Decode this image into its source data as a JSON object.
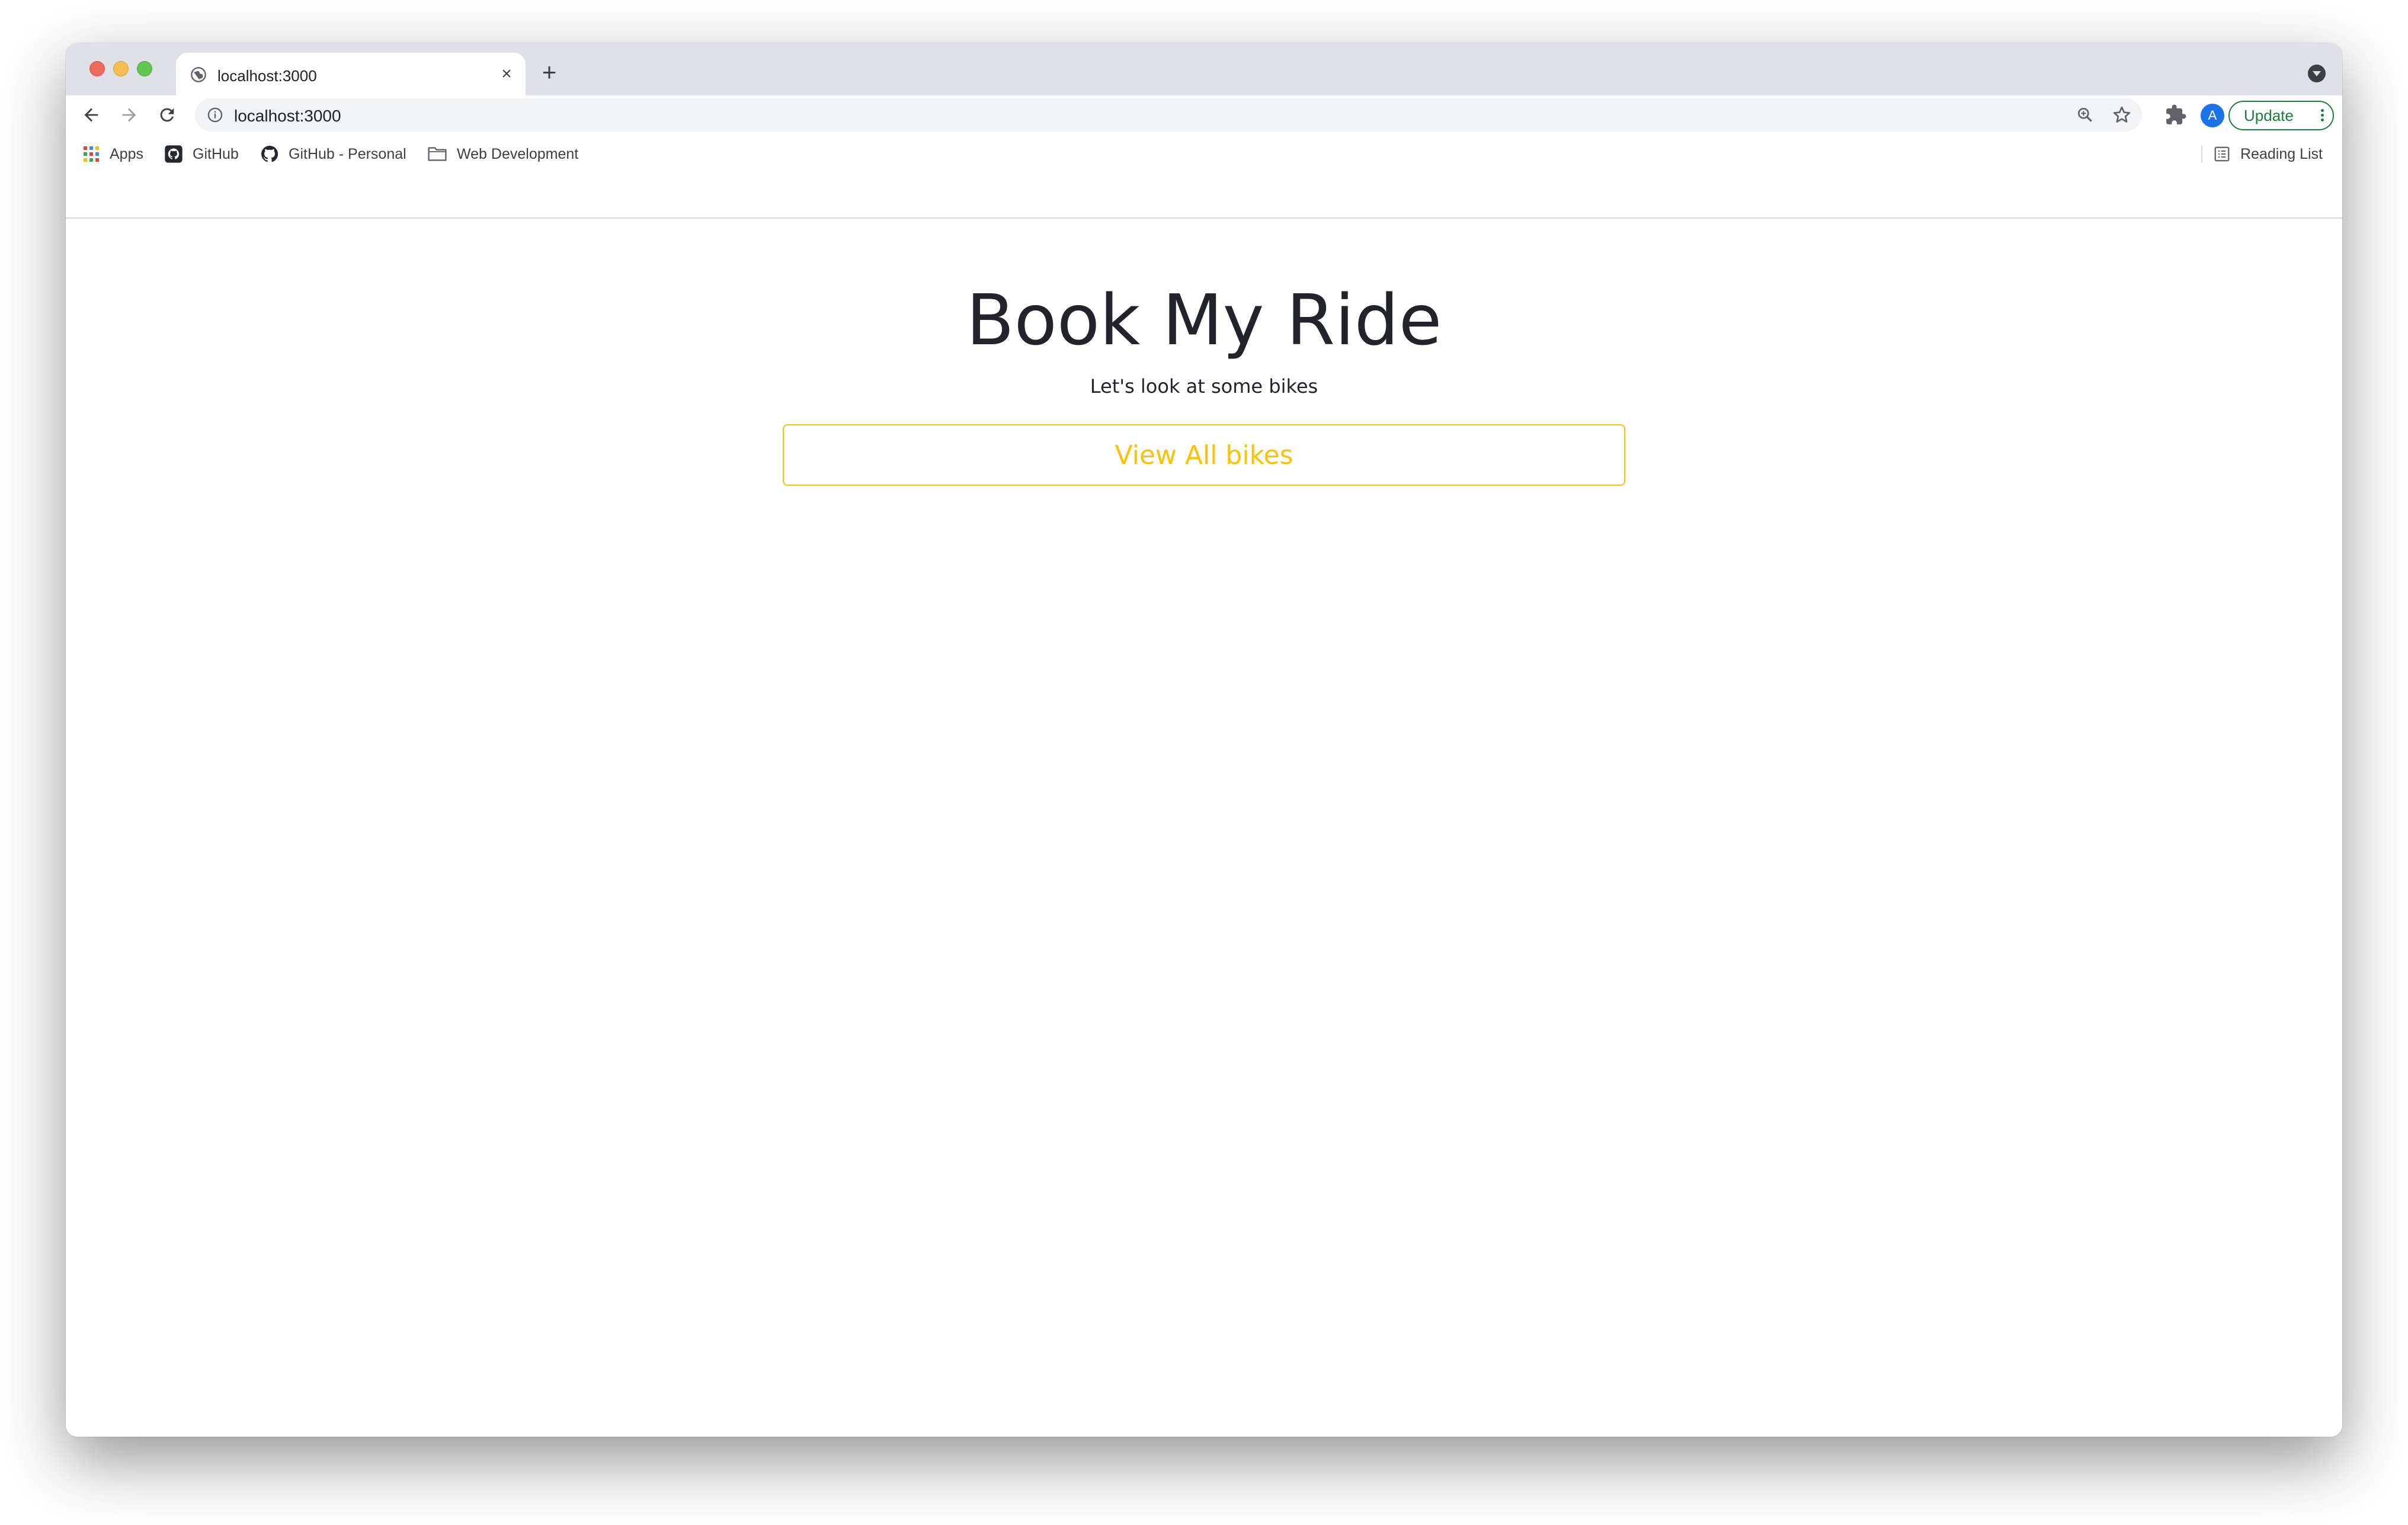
{
  "browser": {
    "tab": {
      "title": "localhost:3000",
      "close_glyph": "×",
      "favicon": "globe-icon"
    },
    "new_tab_glyph": "+",
    "address_bar": {
      "url": "localhost:3000"
    },
    "profile_initial": "A",
    "update_label": "Update",
    "colors": {
      "update_green": "#188038",
      "avatar_blue": "#1a73e8"
    }
  },
  "bookmarks": [
    {
      "label": "Apps",
      "icon": "apps-grid-icon"
    },
    {
      "label": "GitHub",
      "icon": "github-icon"
    },
    {
      "label": "GitHub - Personal",
      "icon": "github-octocat-icon"
    },
    {
      "label": "Web Development",
      "icon": "folder-icon"
    }
  ],
  "reading_list": {
    "label": "Reading List",
    "icon": "reading-list-icon"
  },
  "page": {
    "title": "Book My Ride",
    "subtitle": "Let's look at some bikes",
    "button_label": "View All bikes",
    "colors": {
      "accent": "#ffc107",
      "text": "#212529"
    }
  }
}
